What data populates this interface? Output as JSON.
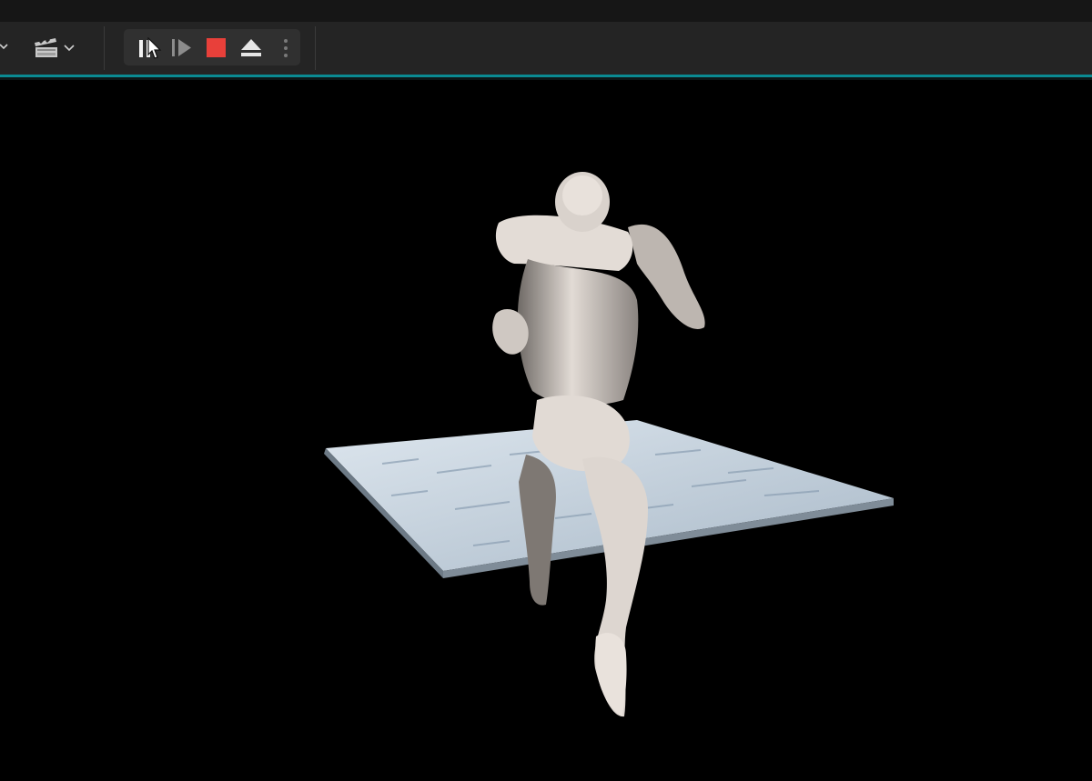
{
  "window": {
    "title": ""
  },
  "toolbar": {
    "left_dropdown": {
      "icon": "chevron-down-icon"
    },
    "cinematics": {
      "icon": "clapperboard-icon",
      "dropdown_icon": "chevron-down-icon"
    },
    "play_controls": {
      "pause": {
        "icon": "pause-icon",
        "state": "active"
      },
      "advance_frame": {
        "icon": "frame-advance-icon",
        "state": "disabled"
      },
      "stop": {
        "icon": "stop-icon",
        "color": "#e8403a"
      },
      "eject": {
        "icon": "eject-icon"
      },
      "more": {
        "icon": "kebab-menu-icon"
      }
    }
  },
  "viewport": {
    "scene": {
      "floor_color": "#b9c7d4",
      "character_color": "#ddd6d0",
      "background": "#000000"
    }
  },
  "colors": {
    "toolbar_bg": "#242424",
    "accent": "#0a8a92",
    "stop_red": "#e8403a"
  }
}
